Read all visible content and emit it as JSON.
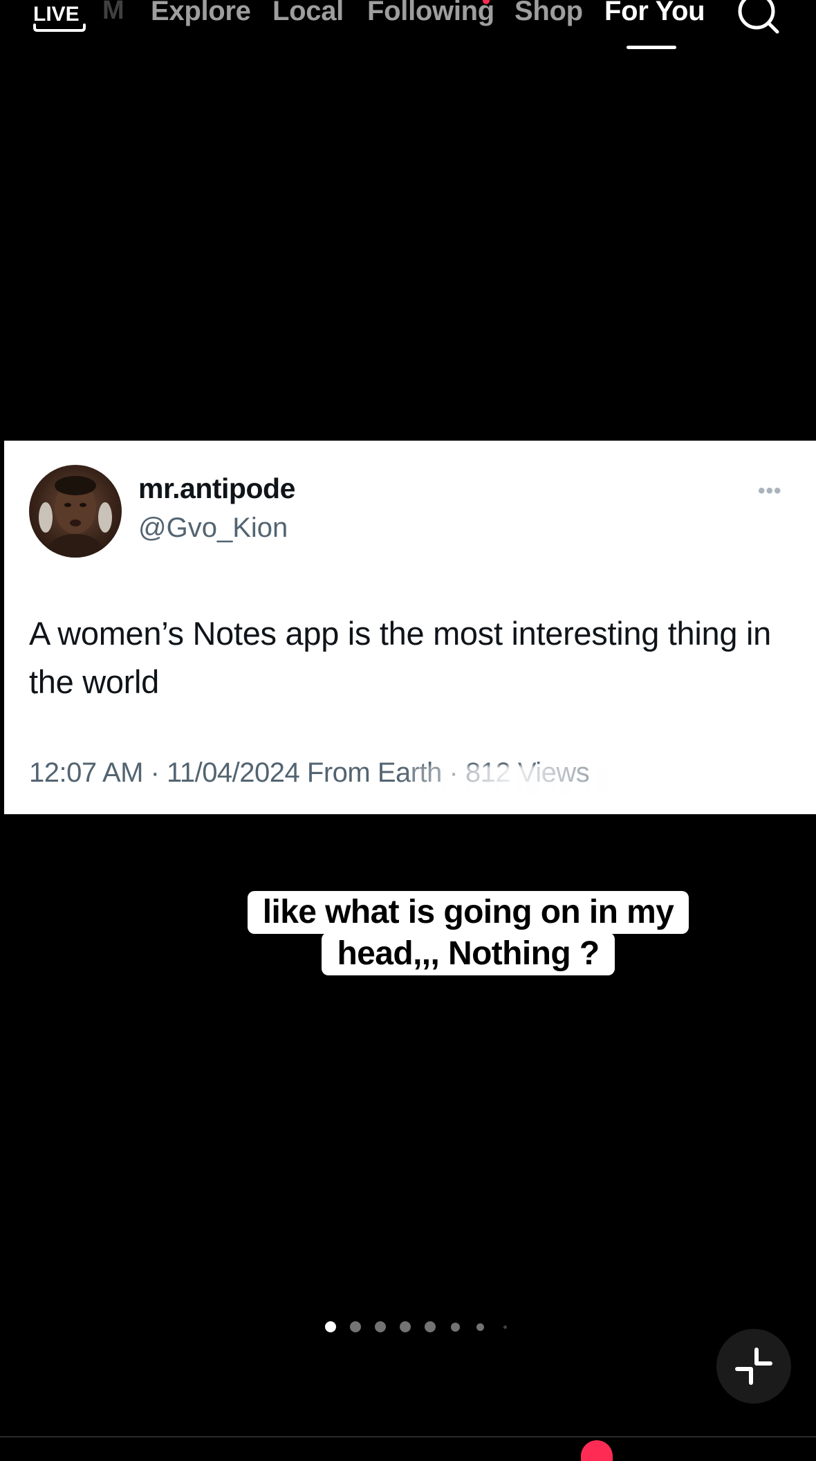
{
  "nav": {
    "live_label": "LIVE",
    "partial_item": "M",
    "tabs": [
      {
        "label": "Explore",
        "active": false
      },
      {
        "label": "Local",
        "active": false
      },
      {
        "label": "Following",
        "active": false,
        "has_notification": true
      },
      {
        "label": "Shop",
        "active": false
      },
      {
        "label": "For You",
        "active": true
      }
    ],
    "search_icon": "search-icon"
  },
  "tweet": {
    "display_name": "mr.antipode",
    "handle": "@Gvo_Kion",
    "more_icon": "more-horizontal-icon",
    "text": "A women’s Notes app is the most interesting thing in the world",
    "meta": "12:07 AM · 11/04/2024 From Earth · 812 Views"
  },
  "caption": {
    "line1": "like what is going on in my",
    "line2": "head,,, Nothing ?"
  },
  "carousel": {
    "total_visible_dots": 8,
    "active_index": 0
  },
  "colors": {
    "background": "#000000",
    "accent": "#fe2c55",
    "tweet_text": "#0f1419",
    "tweet_secondary": "#536471"
  },
  "icons": {
    "collapse": "collapse-icon",
    "live": "live-icon"
  }
}
